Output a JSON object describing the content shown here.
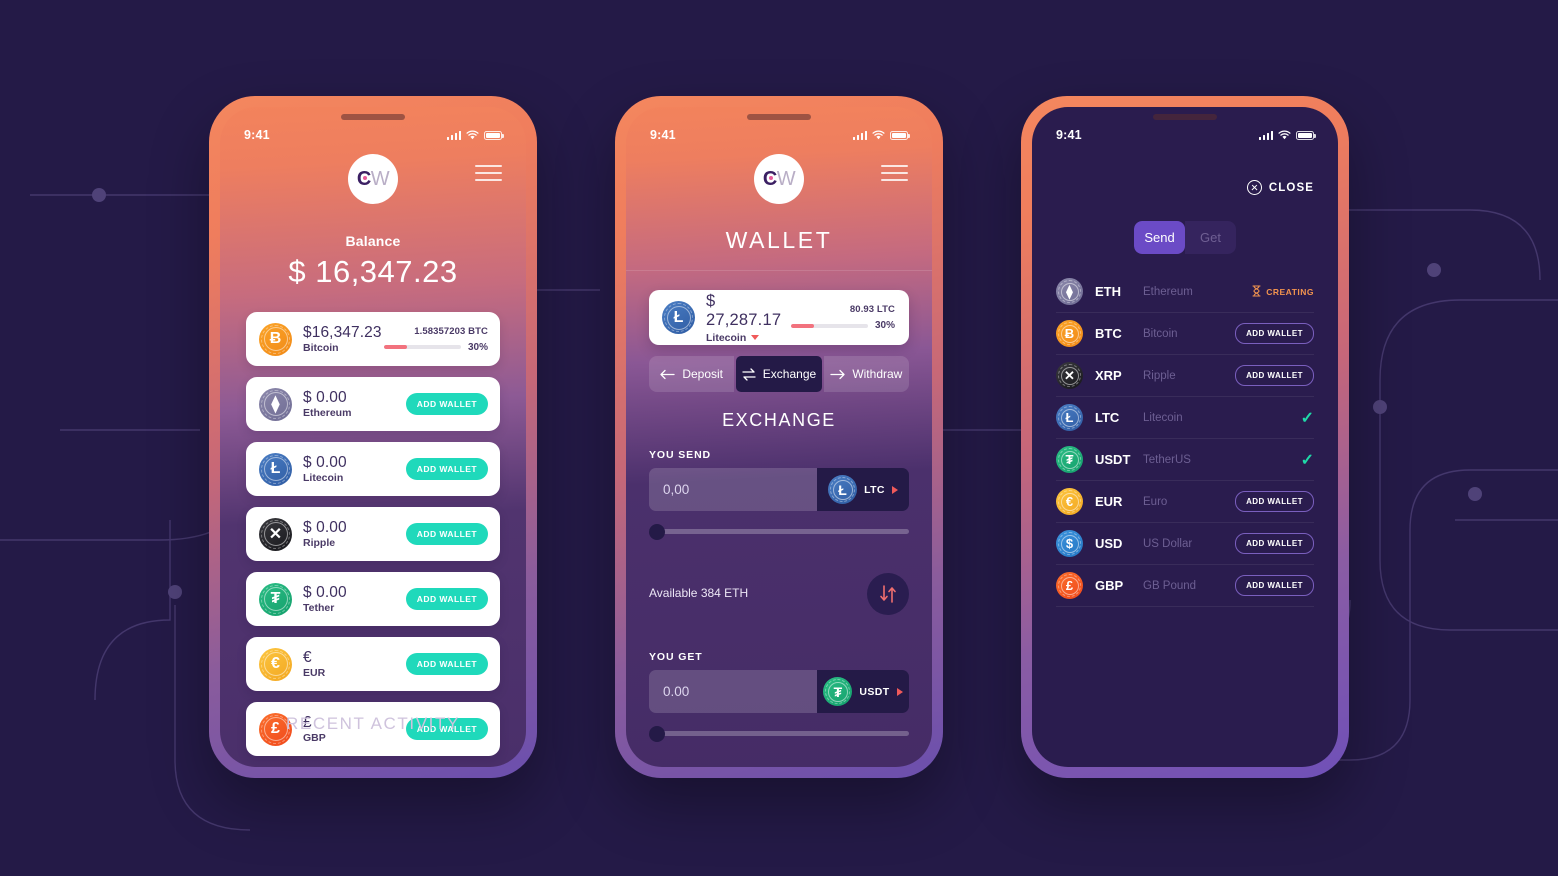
{
  "theme": {
    "bg": "#241a47",
    "accent_teal": "#1fd9bb",
    "accent_purple": "#6b4bc6",
    "accent_orange": "#f2944e",
    "accent_red": "#f2727e"
  },
  "statusbar": {
    "time": "9:41"
  },
  "brand": {
    "logo_c": "C",
    "logo_w": "W"
  },
  "phone1": {
    "balance_label": "Balance",
    "balance_amount": "$ 16,347.23",
    "recent_activity": "RECENT ACTIVITY",
    "add_wallet_label": "ADD WALLET",
    "wallets": [
      {
        "symbol": "BTC",
        "name": "Bitcoin",
        "amount": "$16,347.23",
        "crypto": "1.58357203 BTC",
        "percent": "30%",
        "percent_value": 30,
        "action": "progress",
        "icon": "bitcoin-icon",
        "glyph": "Ƀ"
      },
      {
        "symbol": "ETH",
        "name": "Ethereum",
        "amount": "$ 0.00",
        "action": "add",
        "icon": "ethereum-icon",
        "glyph": "⧫"
      },
      {
        "symbol": "LTC",
        "name": "Litecoin",
        "amount": "$ 0.00",
        "action": "add",
        "icon": "litecoin-icon",
        "glyph": "Ł"
      },
      {
        "symbol": "XRP",
        "name": "Ripple",
        "amount": "$ 0.00",
        "action": "add",
        "icon": "ripple-icon",
        "glyph": "✕"
      },
      {
        "symbol": "USDT",
        "name": "Tether",
        "amount": "$ 0.00",
        "action": "add",
        "icon": "tether-icon",
        "glyph": "₮"
      },
      {
        "symbol": "EUR",
        "name": "EUR",
        "amount": "€",
        "action": "add",
        "icon": "euro-icon",
        "glyph": "€"
      },
      {
        "symbol": "GBP",
        "name": "GBP",
        "amount": "£",
        "action": "add",
        "icon": "pound-icon",
        "glyph": "£"
      }
    ]
  },
  "phone2": {
    "title": "WALLET",
    "wallet_card": {
      "amount": "$ 27,287.17",
      "name": "Litecoin",
      "crypto": "80.93 LTC",
      "percent": "30%",
      "percent_value": 30,
      "icon": "litecoin-icon",
      "glyph": "Ł"
    },
    "segments": [
      {
        "label": "Deposit",
        "icon": "arrow-left-icon",
        "active": false
      },
      {
        "label": "Exchange",
        "icon": "swap-h-icon",
        "active": true
      },
      {
        "label": "Withdraw",
        "icon": "arrow-right-icon",
        "active": false
      }
    ],
    "exchange_title": "EXCHANGE",
    "you_send": {
      "label": "YOU SEND",
      "value": "0,00",
      "currency": "LTC",
      "icon": "litecoin-icon",
      "glyph": "Ł",
      "slider_value": 0
    },
    "available": "Available 384 ETH",
    "swap_icon": "swap-vertical-icon",
    "you_get": {
      "label": "YOU GET",
      "value": "0.00",
      "currency": "USDT",
      "icon": "tether-icon",
      "glyph": "₮",
      "slider_value": 0
    }
  },
  "phone3": {
    "close_label": "CLOSE",
    "toggle": {
      "send": "Send",
      "get": "Get",
      "active": "Send"
    },
    "add_wallet_label": "ADD WALLET",
    "creating_label": "CREATING",
    "currencies": [
      {
        "symbol": "ETH",
        "name": "Ethereum",
        "status": "creating",
        "icon": "ethereum-icon",
        "glyph": "⧫"
      },
      {
        "symbol": "BTC",
        "name": "Bitcoin",
        "status": "add",
        "icon": "bitcoin-icon",
        "glyph": "Ƀ"
      },
      {
        "symbol": "XRP",
        "name": "Ripple",
        "status": "add",
        "icon": "ripple-icon",
        "glyph": "✕"
      },
      {
        "symbol": "LTC",
        "name": "Litecoin",
        "status": "check",
        "icon": "litecoin-icon",
        "glyph": "Ł"
      },
      {
        "symbol": "USDT",
        "name": "TetherUS",
        "status": "check",
        "icon": "tether-icon",
        "glyph": "₮"
      },
      {
        "symbol": "EUR",
        "name": "Euro",
        "status": "add",
        "icon": "euro-icon",
        "glyph": "€"
      },
      {
        "symbol": "USD",
        "name": "US Dollar",
        "status": "add",
        "icon": "usd-icon",
        "glyph": "$"
      },
      {
        "symbol": "GBP",
        "name": "GB Pound",
        "status": "add",
        "icon": "pound-icon",
        "glyph": "£"
      }
    ]
  }
}
